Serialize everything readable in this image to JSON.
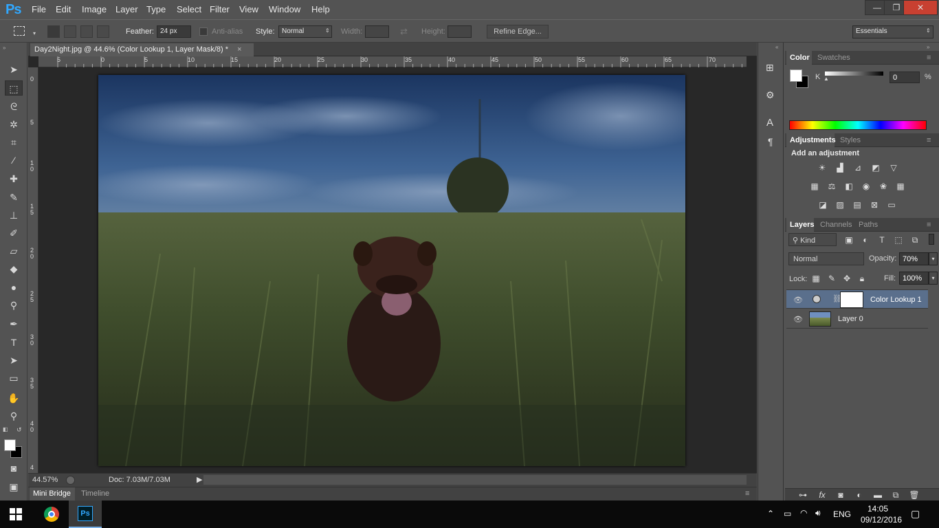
{
  "app": {
    "logo": "Ps"
  },
  "menu": [
    "File",
    "Edit",
    "Image",
    "Layer",
    "Type",
    "Select",
    "Filter",
    "View",
    "Window",
    "Help"
  ],
  "window_controls": {
    "minimize": "—",
    "restore": "❐",
    "close": "✕"
  },
  "options": {
    "feather_label": "Feather:",
    "feather_value": "24 px",
    "antialias_label": "Anti-alias",
    "style_label": "Style:",
    "style_value": "Normal",
    "width_label": "Width:",
    "height_label": "Height:",
    "refine_edge": "Refine Edge...",
    "workspace": "Essentials"
  },
  "document": {
    "tab_title": "Day2Night.jpg @ 44.6% (Color Lookup 1, Layer Mask/8) *",
    "close": "×"
  },
  "ruler_top": [
    "5",
    "0",
    "5",
    "10",
    "15",
    "20",
    "25",
    "30",
    "35",
    "40",
    "45",
    "50",
    "55",
    "60",
    "65",
    "70"
  ],
  "ruler_left": [
    "0",
    "5",
    "1 0",
    "1 5",
    "2 0",
    "2 5",
    "3 0",
    "3 5",
    "4 0",
    "4"
  ],
  "status": {
    "zoom": "44.57%",
    "doc": "Doc: 7.03M/7.03M"
  },
  "bottom_tabs": {
    "mini_bridge": "Mini Bridge",
    "timeline": "Timeline"
  },
  "color_panel": {
    "tabs": [
      "Color",
      "Swatches"
    ],
    "channel": "K",
    "value": "0",
    "unit": "%"
  },
  "adjustments_panel": {
    "tabs": [
      "Adjustments",
      "Styles"
    ],
    "heading": "Add an adjustment"
  },
  "layers_panel": {
    "tabs": [
      "Layers",
      "Channels",
      "Paths"
    ],
    "filter": "Kind",
    "blend_mode": "Normal",
    "opacity_label": "Opacity:",
    "opacity_value": "70%",
    "lock_label": "Lock:",
    "fill_label": "Fill:",
    "fill_value": "100%",
    "layers": [
      {
        "name": "Color Lookup 1"
      },
      {
        "name": "Layer 0"
      }
    ]
  },
  "taskbar": {
    "language": "ENG",
    "time": "14:05",
    "date": "09/12/2016"
  },
  "colors": {
    "accent_blue": "#31a8ff",
    "selected_layer": "#5a6f8c",
    "panel": "#535353",
    "dark": "#424242"
  }
}
